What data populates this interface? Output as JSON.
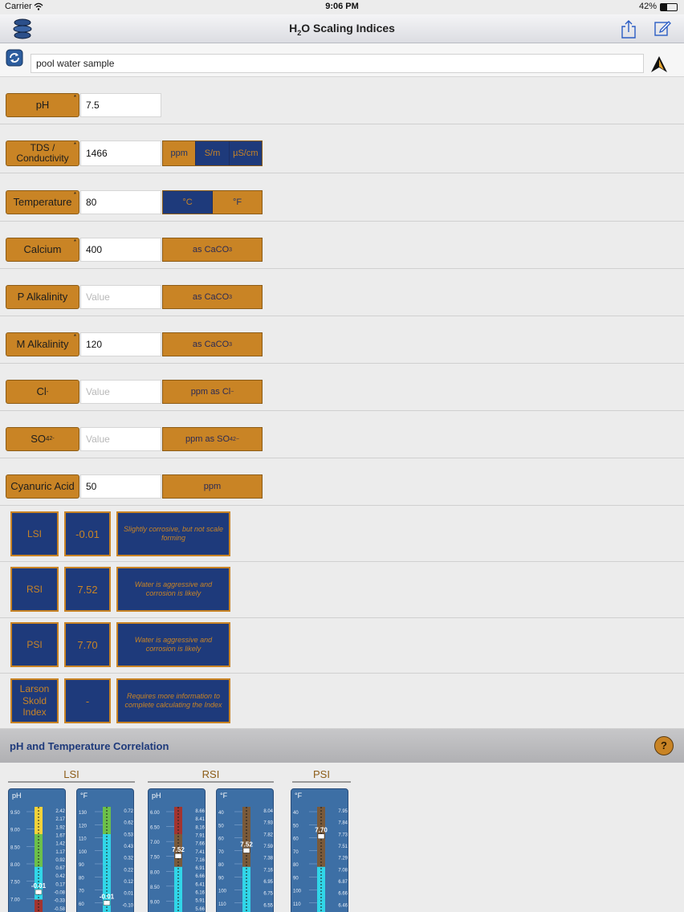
{
  "status": {
    "carrier": "Carrier",
    "time": "9:06 PM",
    "battery": "42%"
  },
  "nav": {
    "title_main": "H",
    "title_sub": "2",
    "title_rest": "O Scaling Indices"
  },
  "sample": {
    "name": "pool water sample"
  },
  "params": [
    {
      "label": "pH",
      "value": "7.5"
    },
    {
      "label": "TDS / Conductivity",
      "value": "1466"
    },
    {
      "label": "Temperature",
      "value": "80"
    },
    {
      "label": "Calcium",
      "value": "400",
      "unit": "as CaCO",
      "unit_sub": "3"
    },
    {
      "label": "P Alkalinity",
      "placeholder": "Value",
      "unit": "as CaCO",
      "unit_sub": "3"
    },
    {
      "label": "M Alkalinity",
      "value": "120",
      "unit": "as CaCO",
      "unit_sub": "3"
    },
    {
      "label": "Cl",
      "label_sup": "-",
      "placeholder": "Value",
      "unit": "ppm as Cl",
      "unit_sup": "−"
    },
    {
      "label": "SO",
      "label_sub": "4",
      "label_sup": "2-",
      "placeholder": "Value",
      "unit": "ppm as SO",
      "unit_sub": "4",
      "unit_sup": "2−"
    },
    {
      "label": "Cyanuric Acid",
      "value": "50",
      "unit": "ppm"
    }
  ],
  "tds_units": [
    "ppm",
    "S/m",
    "µS/cm"
  ],
  "temp_units": [
    "°C",
    "°F"
  ],
  "indices": [
    {
      "name": "LSI",
      "value": "-0.01",
      "desc": "Slightly corrosive, but not scale forming"
    },
    {
      "name": "RSI",
      "value": "7.52",
      "desc": "Water is aggressive and corrosion is likely"
    },
    {
      "name": "PSI",
      "value": "7.70",
      "desc": "Water is aggressive and corrosion is likely"
    },
    {
      "name": "Larson Skold Index",
      "value": "-",
      "desc": "Requires more information to complete calculating the Index"
    }
  ],
  "correlation": {
    "title": "pH and Temperature Correlation",
    "help": "?",
    "groups": [
      "LSI",
      "RSI",
      "PSI"
    ]
  },
  "gauges": [
    {
      "unit": "pH",
      "left_ticks": [
        "9.50",
        "9.00",
        "8.50",
        "8.00",
        "7.50",
        "7.00"
      ],
      "right_ticks": [
        "2.42",
        "2.17",
        "1.92",
        "1.67",
        "1.42",
        "1.17",
        "0.92",
        "0.67",
        "0.42",
        "0.17",
        "-0.08",
        "-0.33",
        "-0.58"
      ],
      "marker": "-0.01",
      "marker_pos": 0.78,
      "color_top": "#f2d23a",
      "color_mid": "#6cc04a",
      "color_low": "#31d6e8",
      "color_bottom": "#a3342f"
    },
    {
      "unit": "°F",
      "left_ticks": [
        "130",
        "120",
        "110",
        "100",
        "90",
        "80",
        "70",
        "60"
      ],
      "right_ticks": [
        "0.72",
        "0.62",
        "0.53",
        "0.43",
        "0.32",
        "0.22",
        "0.12",
        "0.01",
        "-0.10"
      ],
      "marker": "-0.01",
      "marker_pos": 0.88,
      "color_top": "#6cc04a",
      "color_mid": "#31d6e8",
      "color_low": "#31d6e8",
      "color_bottom": "#31d6e8"
    },
    {
      "unit": "pH",
      "left_ticks": [
        "6.00",
        "6.50",
        "7.00",
        "7.50",
        "8.00",
        "8.50",
        "9.00"
      ],
      "right_ticks": [
        "8.66",
        "8.41",
        "8.16",
        "7.91",
        "7.66",
        "7.41",
        "7.16",
        "6.91",
        "6.66",
        "6.41",
        "6.16",
        "5.91",
        "5.66"
      ],
      "marker": "7.52",
      "marker_pos": 0.45,
      "color_top": "#a3342f",
      "color_mid": "#7a5a3a",
      "color_low": "#31d6e8",
      "color_bottom": "#31d6e8"
    },
    {
      "unit": "°F",
      "left_ticks": [
        "40",
        "50",
        "60",
        "70",
        "80",
        "90",
        "100",
        "110"
      ],
      "right_ticks": [
        "8.04",
        "7.93",
        "7.82",
        "7.59",
        "7.38",
        "7.16",
        "6.95",
        "6.75",
        "6.55"
      ],
      "marker": "7.52",
      "marker_pos": 0.4,
      "color_top": "#7a5a3a",
      "color_mid": "#7a5a3a",
      "color_low": "#31d6e8",
      "color_bottom": "#31d6e8"
    },
    {
      "unit": "°F",
      "left_ticks": [
        "40",
        "50",
        "60",
        "70",
        "80",
        "90",
        "100",
        "110"
      ],
      "right_ticks": [
        "7.95",
        "7.84",
        "7.73",
        "7.51",
        "7.29",
        "7.08",
        "6.87",
        "6.66",
        "6.46"
      ],
      "marker": "7.70",
      "marker_pos": 0.27,
      "color_top": "#7a5a3a",
      "color_mid": "#7a5a3a",
      "color_low": "#31d6e8",
      "color_bottom": "#31d6e8"
    }
  ]
}
